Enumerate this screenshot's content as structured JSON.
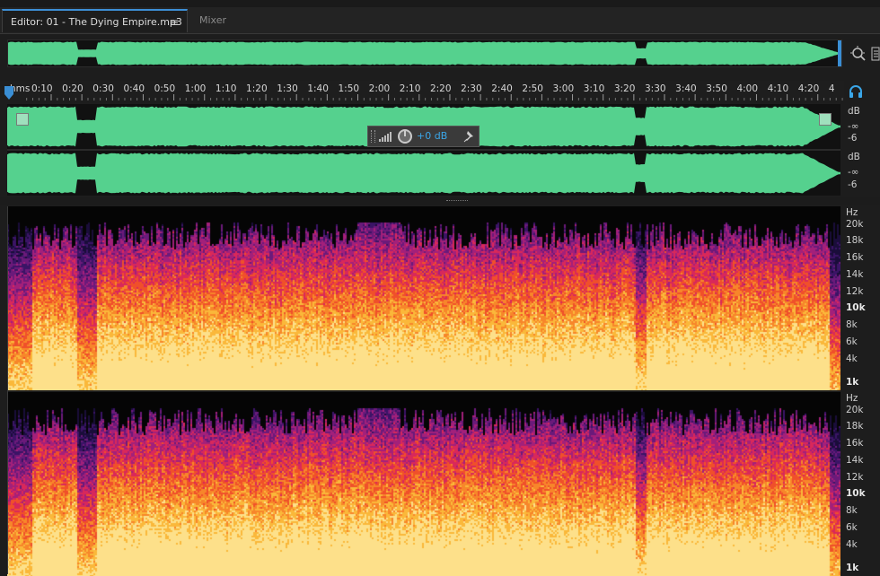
{
  "editor": {
    "tab_label": "Editor: 01 - The Dying Empire.mp3",
    "tab_menu_icon": "hamburger-menu-icon",
    "mixer_label": "Mixer"
  },
  "timeline": {
    "unit_label": "hms",
    "ticks": [
      "0:10",
      "0:20",
      "0:30",
      "0:40",
      "0:50",
      "1:00",
      "1:10",
      "1:20",
      "1:30",
      "1:40",
      "1:50",
      "2:00",
      "2:10",
      "2:20",
      "2:30",
      "2:40",
      "2:50",
      "3:00",
      "3:10",
      "3:20",
      "3:30",
      "3:40",
      "3:50",
      "4:00",
      "4:10",
      "4:20",
      "4"
    ]
  },
  "hud": {
    "gain_label": "+0 dB"
  },
  "db_scale": {
    "unit": "dB",
    "inf": "-∞",
    "minus6": "-6"
  },
  "hz_scale": {
    "unit": "Hz",
    "labels": [
      "20k",
      "18k",
      "16k",
      "14k",
      "12k",
      "10k",
      "8k",
      "6k",
      "4k",
      "1k"
    ]
  },
  "colors": {
    "waveform": "#55d18e",
    "accent": "#3a8ed4",
    "gain_text": "#3aa6e8"
  }
}
